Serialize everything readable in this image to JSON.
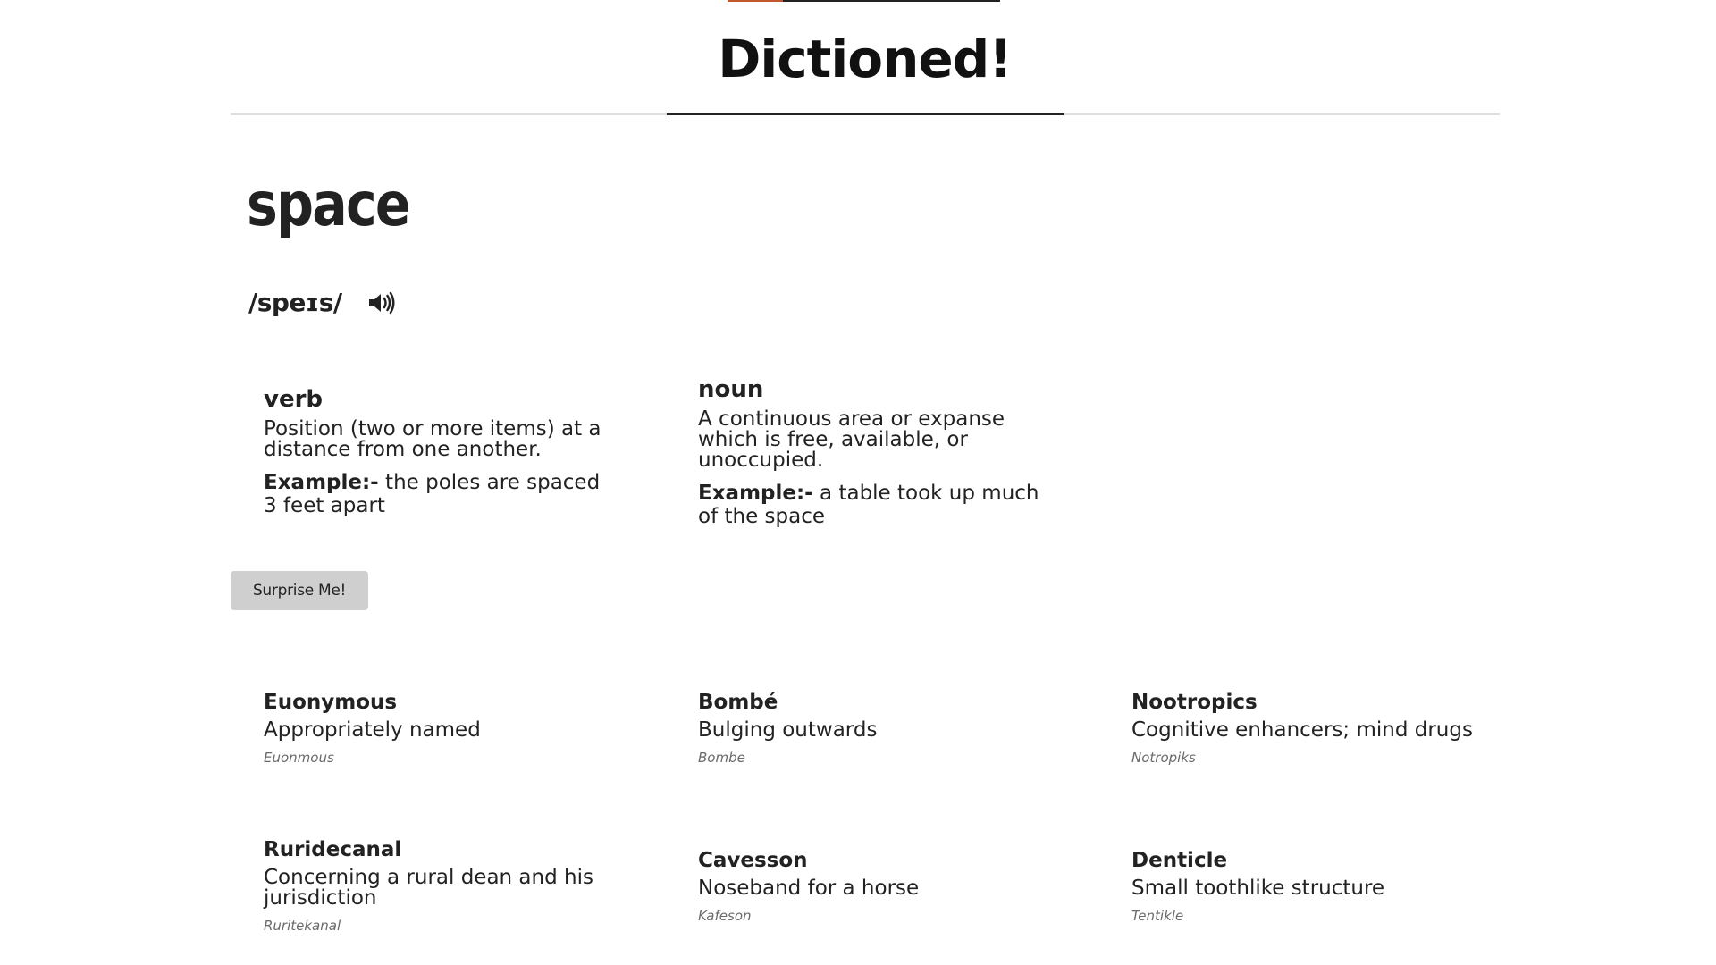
{
  "site": {
    "title": "Dictioned!",
    "accent_color": "#c2572e"
  },
  "word": {
    "text": "space",
    "pronunciation": "/speɪs/",
    "audio_icon": "speaker-icon",
    "meanings": [
      {
        "part_of_speech": "verb",
        "definition": "Position (two or more items) at a distance from one another.",
        "example_label": "Example:-",
        "example": " the poles are spaced 3 feet apart"
      },
      {
        "part_of_speech": "noun",
        "definition": "A continuous area or expanse which is free, available, or unoccupied.",
        "example_label": "Example:-",
        "example": " a table took up much of the space"
      }
    ]
  },
  "surprise_button": {
    "label": "Surprise Me!"
  },
  "cards": [
    {
      "word": "Euonymous",
      "meaning": "Appropriately named",
      "pronunciation": "Euonmous"
    },
    {
      "word": "Bombé",
      "meaning": "Bulging outwards",
      "pronunciation": "Bombe"
    },
    {
      "word": "Nootropics",
      "meaning": "Cognitive enhancers; mind drugs",
      "pronunciation": "Notropiks"
    },
    {
      "word": "Ruridecanal",
      "meaning": "Concerning a rural dean and his jurisdiction",
      "pronunciation": "Ruritekanal"
    },
    {
      "word": "Cavesson",
      "meaning": "Noseband for a horse",
      "pronunciation": "Kafeson"
    },
    {
      "word": "Denticle",
      "meaning": "Small toothlike structure",
      "pronunciation": "Tentikle"
    }
  ]
}
